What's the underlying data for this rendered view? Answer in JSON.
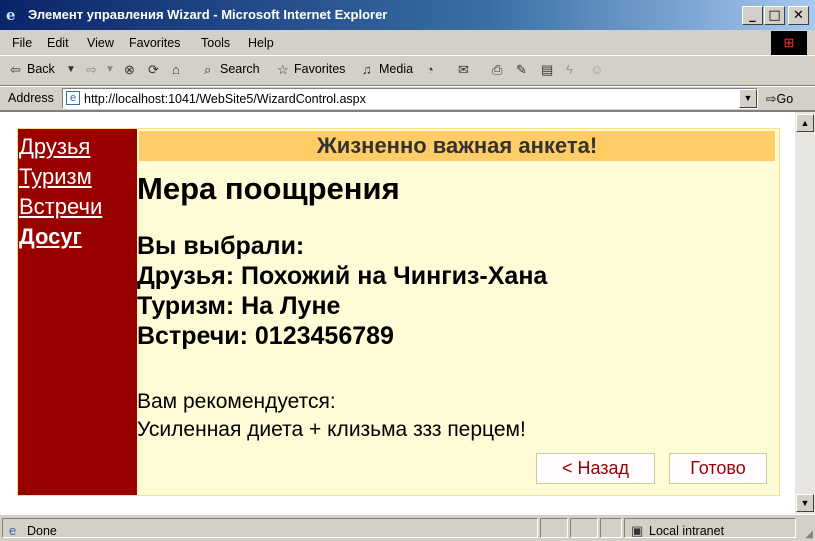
{
  "window": {
    "title": "Элемент управления Wizard - Microsoft Internet Explorer",
    "app_icon": "e",
    "controls": {
      "minimize": "_",
      "maximize": "□",
      "close": "✕"
    }
  },
  "menu": {
    "items": [
      "File",
      "Edit",
      "View",
      "Favorites",
      "Tools",
      "Help"
    ]
  },
  "toolbar": {
    "back": "Back",
    "search": "Search",
    "favorites": "Favorites",
    "media": "Media"
  },
  "address": {
    "label": "Address",
    "url": "http://localhost:1041/WebSite5/WizardControl.aspx",
    "go": "Go"
  },
  "wizard": {
    "header": "Жизненно важная анкета!",
    "sidebar": [
      {
        "label": "Друзья",
        "active": false
      },
      {
        "label": "Туризм",
        "active": false
      },
      {
        "label": "Встречи",
        "active": false
      },
      {
        "label": "Досуг",
        "active": true
      }
    ],
    "step_title": "Мера поощрения",
    "summary": [
      "Вы выбрали:",
      "Друзья: Похожий на Чингиз-Хана",
      "Туризм: На Луне",
      "Встречи: 0123456789"
    ],
    "recommend_label": "Вам рекомендуется:",
    "recommend_text": "Усиленная диета + клизьма ззз перцем!",
    "buttons": {
      "back": "< Назад",
      "finish": "Готово"
    }
  },
  "status": {
    "text": "Done",
    "zone": "Local intranet"
  },
  "colors": {
    "sidebar_bg": "#990000",
    "header_bg": "#ffcc66",
    "content_bg": "#fffbd6",
    "button_text": "#990000"
  }
}
